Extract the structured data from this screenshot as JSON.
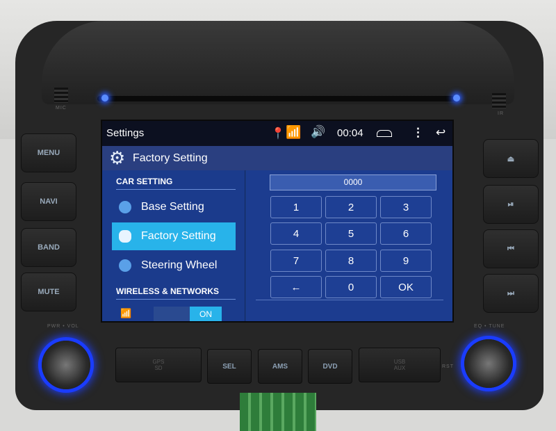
{
  "device": {
    "mic_label": "MIC",
    "ir_label": "IR",
    "left_buttons": [
      "MENU",
      "NAVI",
      "BAND",
      "MUTE"
    ],
    "right_buttons": [
      {
        "icon": "eject-icon",
        "glyph": "⏏"
      },
      {
        "icon": "play-pause-icon",
        "glyph": "⏯"
      },
      {
        "icon": "previous-icon",
        "glyph": "⏮"
      },
      {
        "icon": "next-icon",
        "glyph": "⏭"
      }
    ],
    "left_knob_label": "PWR • VOL",
    "right_knob_label": "EQ • TUNE",
    "bottom_buttons": {
      "gps_top": "GPS",
      "gps_bottom": "SD",
      "sel": "SEL",
      "ams": "AMS",
      "dvd": "DVD",
      "usb_top": "USB",
      "usb_bottom": "AUX",
      "rst": "RST"
    },
    "led_color": "#2b5cff"
  },
  "screen": {
    "status": {
      "title": "Settings",
      "time": "00:04",
      "icons": [
        "location-icon",
        "wifi-icon",
        "volume-icon",
        "home-icon",
        "menu-icon",
        "back-icon"
      ]
    },
    "header": {
      "title": "Factory Setting",
      "icon": "gear-icon"
    },
    "sidebar": {
      "car_section": "CAR SETTING",
      "items": [
        {
          "label": "Base Setting",
          "selected": false
        },
        {
          "label": "Factory Setting",
          "selected": true
        },
        {
          "label": "Steering Wheel",
          "selected": false
        }
      ],
      "wireless_section": "WIRELESS & NETWORKS",
      "wifi_toggle": "ON"
    },
    "keypad": {
      "code_value": "0000",
      "keys": [
        "1",
        "2",
        "3",
        "4",
        "5",
        "6",
        "7",
        "8",
        "9",
        "←",
        "0",
        "OK"
      ]
    },
    "accent_color": "#28b3ea"
  }
}
